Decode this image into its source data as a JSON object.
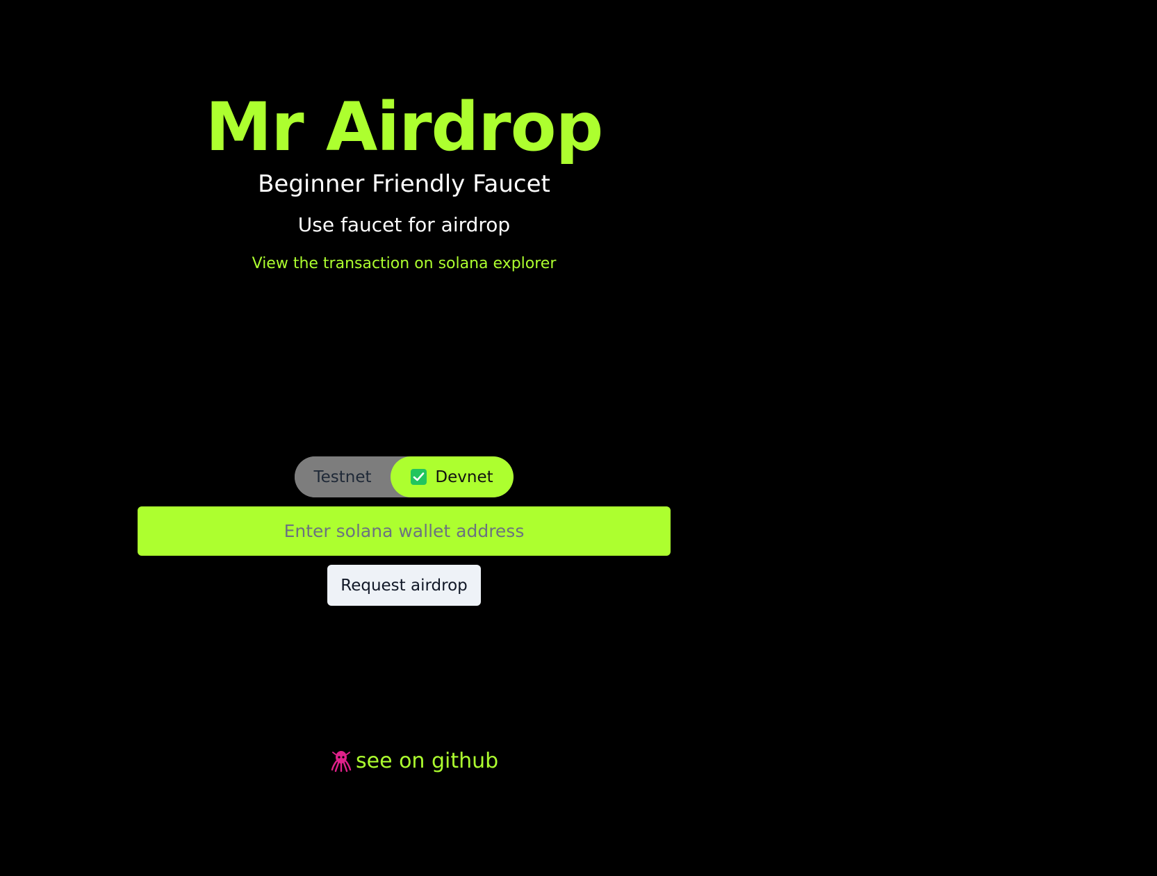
{
  "header": {
    "title": "Mr Airdrop",
    "subtitle": "Beginner Friendly Faucet",
    "hint": "Use faucet for airdrop",
    "explorer_link": "View the transaction on solana explorer"
  },
  "network_toggle": {
    "options": [
      {
        "label": "Testnet",
        "selected": false
      },
      {
        "label": "Devnet",
        "selected": true
      }
    ]
  },
  "wallet": {
    "value": "",
    "placeholder": "Enter solana wallet address"
  },
  "actions": {
    "request_label": "Request airdrop"
  },
  "footer": {
    "github_label": "see on github",
    "github_icon": "octopus-icon"
  },
  "colors": {
    "background": "#000000",
    "accent": "#adff2f",
    "toggle_inactive": "#7d7d7d",
    "check": "#22c55e",
    "button": "#eef2f7",
    "github_icon": "#e0218a"
  }
}
